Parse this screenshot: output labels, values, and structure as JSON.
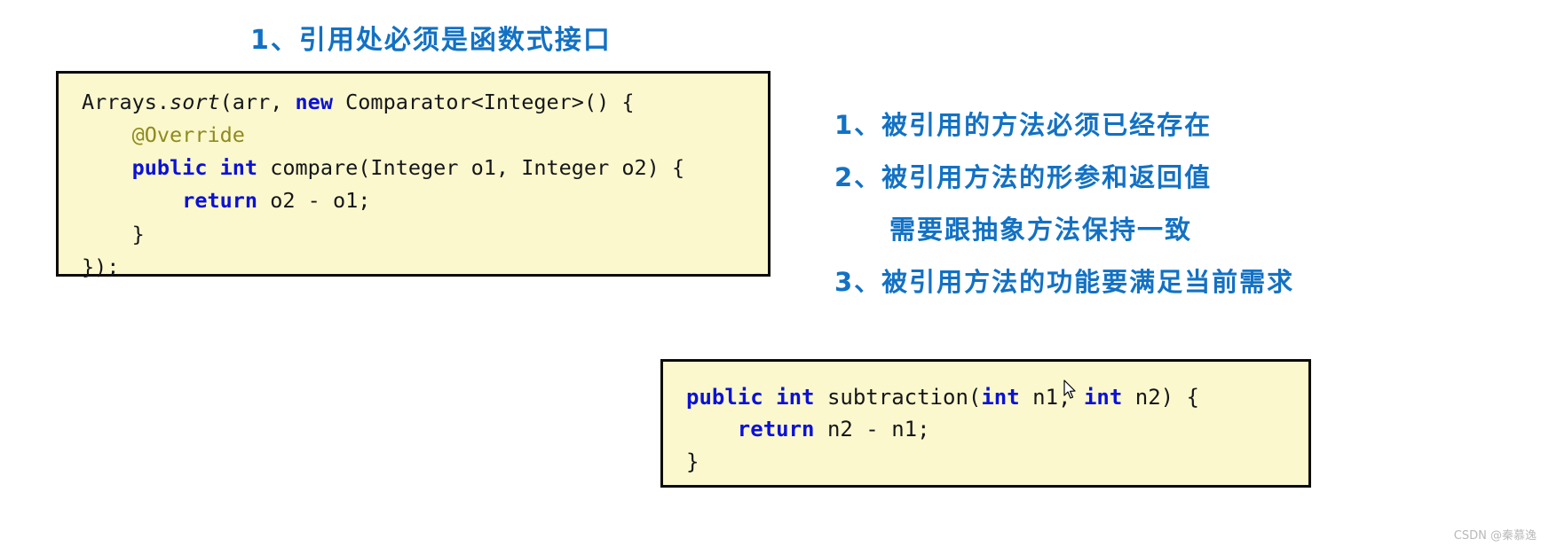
{
  "title": "1、引用处必须是函数式接口",
  "code_top": {
    "lines": [
      [
        {
          "t": "Arrays.",
          "s": "plain"
        },
        {
          "t": "sort",
          "s": "ital"
        },
        {
          "t": "(arr, ",
          "s": "plain"
        },
        {
          "t": "new",
          "s": "kw"
        },
        {
          "t": " Comparator<Integer>() {",
          "s": "plain"
        }
      ],
      [
        {
          "t": "    ",
          "s": "plain"
        },
        {
          "t": "@Override",
          "s": "ann"
        }
      ],
      [
        {
          "t": "    ",
          "s": "plain"
        },
        {
          "t": "public int",
          "s": "kw"
        },
        {
          "t": " compare(Integer o1, Integer o2) {",
          "s": "plain"
        }
      ],
      [
        {
          "t": "        ",
          "s": "plain"
        },
        {
          "t": "return",
          "s": "kw"
        },
        {
          "t": " o2 - o1;",
          "s": "plain"
        }
      ],
      [
        {
          "t": "    }",
          "s": "plain"
        }
      ],
      [
        {
          "t": "});",
          "s": "plain"
        }
      ]
    ]
  },
  "code_bottom": {
    "lines": [
      [
        {
          "t": "public int",
          "s": "kw"
        },
        {
          "t": " subtraction(",
          "s": "plain"
        },
        {
          "t": "int",
          "s": "kw"
        },
        {
          "t": " n1, ",
          "s": "plain"
        },
        {
          "t": "int",
          "s": "kw"
        },
        {
          "t": " n2) {",
          "s": "plain"
        }
      ],
      [
        {
          "t": "    ",
          "s": "plain"
        },
        {
          "t": "return",
          "s": "kw"
        },
        {
          "t": " n2 - n1;",
          "s": "plain"
        }
      ],
      [
        {
          "t": "}",
          "s": "plain"
        }
      ]
    ]
  },
  "notes": [
    {
      "text": "1、被引用的方法必须已经存在",
      "indent": false
    },
    {
      "text": "2、被引用方法的形参和返回值",
      "indent": false
    },
    {
      "text": "需要跟抽象方法保持一致",
      "indent": true
    },
    {
      "text": "3、被引用方法的功能要满足当前需求",
      "indent": false
    }
  ],
  "watermark": "CSDN @秦慕逸",
  "colors": {
    "accent_blue": "#1271c4",
    "keyword_blue": "#0b11d6",
    "annotation_olive": "#8f8a21",
    "code_bg": "#fbf8cd",
    "code_border": "#0c0b06"
  },
  "cursor_icon": "mouse-pointer-icon"
}
